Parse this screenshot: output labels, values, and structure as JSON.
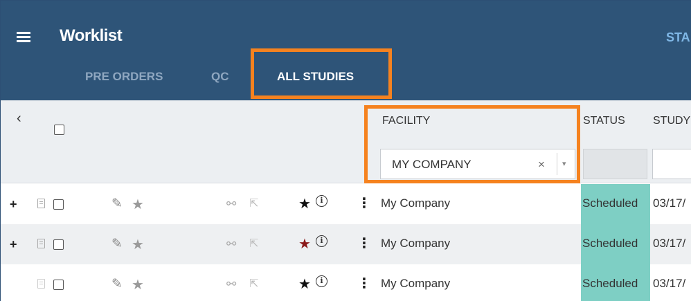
{
  "header": {
    "title": "Worklist",
    "right_label": "STA",
    "tabs": [
      {
        "label": "PRE ORDERS",
        "active": false
      },
      {
        "label": "QC",
        "active": false
      },
      {
        "label": "ALL STUDIES",
        "active": true
      }
    ]
  },
  "columns": {
    "facility": "FACILITY",
    "status": "STATUS",
    "study": "STUDY"
  },
  "filters": {
    "facility_value": "MY COMPANY",
    "clear_glyph": "×",
    "caret_glyph": "▾"
  },
  "icons": {
    "expand": "+",
    "pencil": "✎",
    "star": "★",
    "link": "⚯",
    "external": "⇱",
    "info": "i",
    "kebab": "⋮",
    "collapse": "‹"
  },
  "rows": [
    {
      "facility": "My Company",
      "status": "Scheduled",
      "date": "03/17/",
      "expandable": true,
      "favorite_color": "#111111",
      "bg": "#ffffff"
    },
    {
      "facility": "My Company",
      "status": "Scheduled",
      "date": "03/17/",
      "expandable": true,
      "favorite_color": "#8b1a1a",
      "bg": "#eef0f2"
    },
    {
      "facility": "My Company",
      "status": "Scheduled",
      "date": "03/17/",
      "expandable": false,
      "favorite_color": "#111111",
      "bg": "#ffffff"
    }
  ],
  "colors": {
    "header_bg": "#2e5478",
    "highlight": "#f5821f",
    "status_scheduled": "#7ecfc4"
  }
}
